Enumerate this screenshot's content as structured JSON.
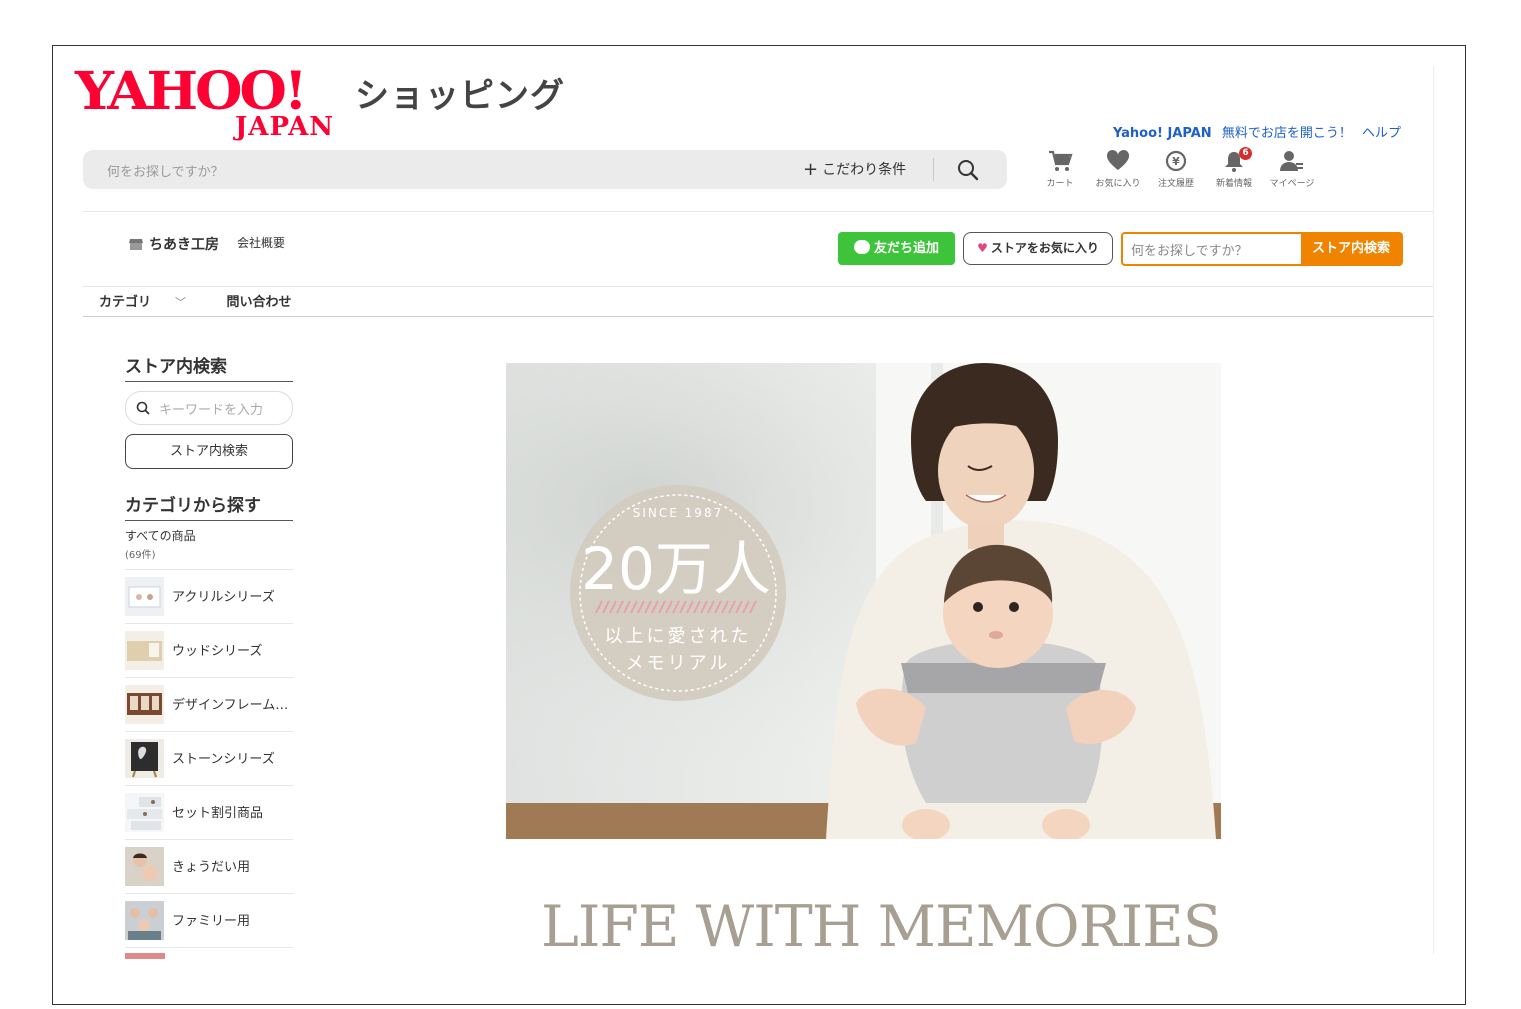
{
  "header": {
    "logo_text": "YAHOO!",
    "logo_sub": "JAPAN",
    "service_name": "ショッピング",
    "links": [
      "Yahoo! JAPAN",
      "無料でお店を開こう！",
      "ヘルプ"
    ],
    "search": {
      "placeholder": "何をお探しですか？",
      "conditions_label": "こだわり条件"
    },
    "icons": [
      {
        "name": "cart-icon",
        "label": "カート"
      },
      {
        "name": "heart-icon",
        "label": "お気に入り"
      },
      {
        "name": "order-history-icon",
        "label": "注文履歴"
      },
      {
        "name": "bell-icon",
        "label": "新着情報",
        "badge": "6"
      },
      {
        "name": "user-icon",
        "label": "マイページ"
      }
    ]
  },
  "store": {
    "name": "ちあき工房",
    "company_link": "会社概要",
    "line_button": "友だち追加",
    "favorite_button": "ストアをお気に入り",
    "search_placeholder": "何をお探しですか？",
    "search_button": "ストア内検索"
  },
  "subnav": {
    "category": "カテゴリ",
    "contact": "問い合わせ"
  },
  "sidebar": {
    "store_search_heading": "ストア内検索",
    "keyword_placeholder": "キーワードを入力",
    "search_button": "ストア内検索",
    "category_heading": "カテゴリから探す",
    "all_items": {
      "label": "すべての商品",
      "count": "(69件)"
    },
    "categories": [
      {
        "label": "アクリルシリーズ",
        "color": "#e9edf0"
      },
      {
        "label": "ウッドシリーズ",
        "color": "#e3d6bd"
      },
      {
        "label": "デザインフレームシリーズ",
        "color": "#7a4a2e"
      },
      {
        "label": "ストーンシリーズ",
        "color": "#2d2d2d"
      },
      {
        "label": "セット割引商品",
        "color": "#edf0f2"
      },
      {
        "label": "きょうだい用",
        "color": "#b9b3aa"
      },
      {
        "label": "ファミリー用",
        "color": "#8a9aa3"
      }
    ]
  },
  "banner": {
    "since": "SINCE 1987",
    "big_number": "20万人",
    "line1": "以上に愛された",
    "line2": "メモリアル"
  },
  "tagline": "LIFE WITH MEMORIES",
  "colors": {
    "brand_red": "#ff0033",
    "link_blue": "#1d60c7",
    "store_orange": "#f08300",
    "line_green": "#3ec43a"
  }
}
